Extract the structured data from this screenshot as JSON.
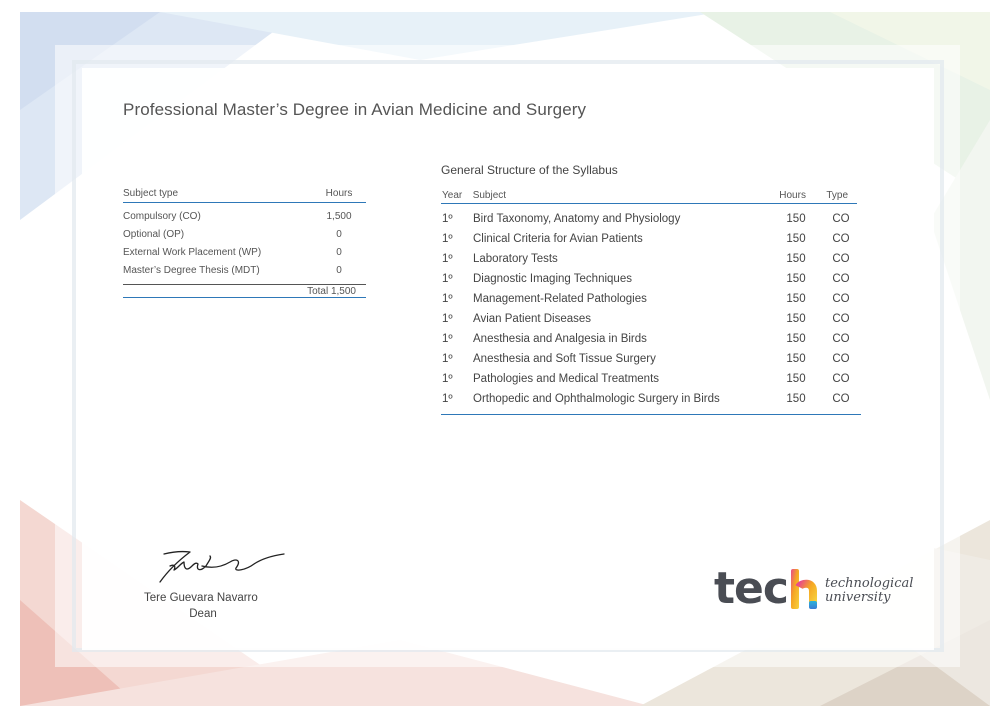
{
  "title": "Professional Master’s Degree in Avian Medicine and Surgery",
  "summary": {
    "header": {
      "type": "Subject type",
      "hours": "Hours"
    },
    "rows": [
      {
        "type": "Compulsory (CO)",
        "hours": "1,500"
      },
      {
        "type": "Optional (OP)",
        "hours": "0"
      },
      {
        "type": "External Work Placement (WP)",
        "hours": "0"
      },
      {
        "type": "Master’s Degree Thesis (MDT)",
        "hours": "0"
      }
    ],
    "total": "Total 1,500"
  },
  "syllabus": {
    "title": "General Structure of the Syllabus",
    "header": {
      "year": "Year",
      "subject": "Subject",
      "hours": "Hours",
      "type": "Type"
    },
    "rows": [
      {
        "year": "1º",
        "subject": "Bird Taxonomy, Anatomy and Physiology",
        "hours": "150",
        "type": "CO"
      },
      {
        "year": "1º",
        "subject": "Clinical Criteria for Avian Patients",
        "hours": "150",
        "type": "CO"
      },
      {
        "year": "1º",
        "subject": "Laboratory Tests",
        "hours": "150",
        "type": "CO"
      },
      {
        "year": "1º",
        "subject": "Diagnostic Imaging Techniques",
        "hours": "150",
        "type": "CO"
      },
      {
        "year": "1º",
        "subject": "Management-Related Pathologies",
        "hours": "150",
        "type": "CO"
      },
      {
        "year": "1º",
        "subject": "Avian Patient Diseases",
        "hours": "150",
        "type": "CO"
      },
      {
        "year": "1º",
        "subject": "Anesthesia and Analgesia in Birds",
        "hours": "150",
        "type": "CO"
      },
      {
        "year": "1º",
        "subject": "Anesthesia and Soft Tissue Surgery",
        "hours": "150",
        "type": "CO"
      },
      {
        "year": "1º",
        "subject": "Pathologies and Medical Treatments",
        "hours": "150",
        "type": "CO"
      },
      {
        "year": "1º",
        "subject": "Orthopedic and Ophthalmologic Surgery in Birds",
        "hours": "150",
        "type": "CO"
      }
    ]
  },
  "signatory": {
    "name": "Tere Guevara Navarro",
    "role": "Dean"
  },
  "logo": {
    "word": "tec",
    "line1": "technological",
    "line2": "university"
  },
  "colors": {
    "rule": "#2e78b8",
    "logo_text": "#4a4d54"
  }
}
